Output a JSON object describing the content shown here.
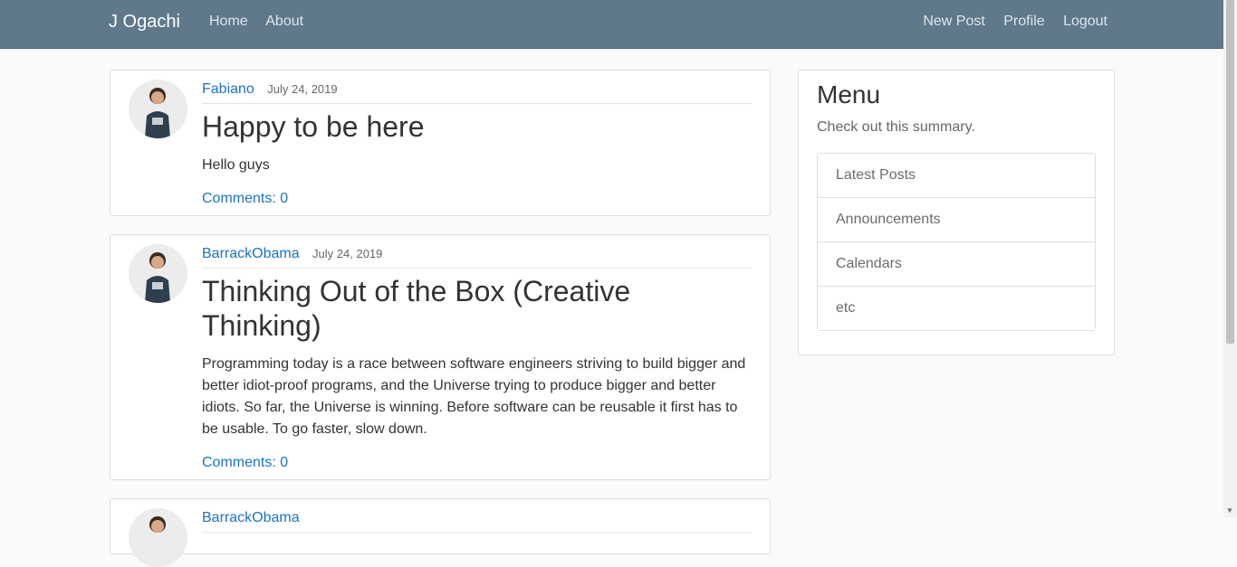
{
  "navbar": {
    "brand": "J Ogachi",
    "left_links": [
      "Home",
      "About"
    ],
    "right_links": [
      "New Post",
      "Profile",
      "Logout"
    ]
  },
  "posts": [
    {
      "author": "Fabiano",
      "date": "July 24, 2019",
      "title": "Happy to be here",
      "content": "Hello guys",
      "comments": "Comments: 0"
    },
    {
      "author": "BarrackObama",
      "date": "July 24, 2019",
      "title": "Thinking Out of the Box (Creative Thinking)",
      "content": "Programming today is a race between software engineers striving to build bigger and better idiot-proof programs, and the Universe trying to produce bigger and better idiots. So far, the Universe is winning. Before software can be reusable it first has to be usable. To go faster, slow down.",
      "comments": "Comments: 0"
    },
    {
      "author": "BarrackObama"
    }
  ],
  "sidebar": {
    "title": "Menu",
    "subtitle": "Check out this summary.",
    "items": [
      "Latest Posts",
      "Announcements",
      "Calendars",
      "etc"
    ]
  }
}
